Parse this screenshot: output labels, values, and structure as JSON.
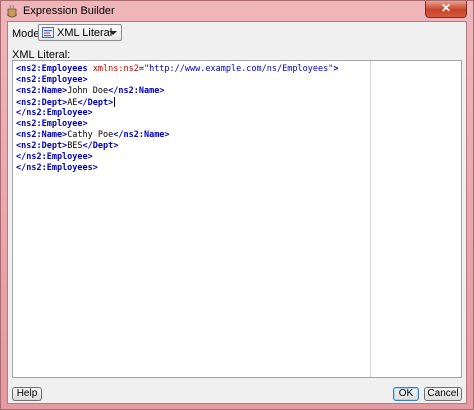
{
  "window": {
    "title": "Expression Builder",
    "close_glyph": "✕"
  },
  "mode": {
    "label": "Mode:",
    "value": "XML Literal"
  },
  "editor": {
    "label": "XML Literal:",
    "lines": [
      [
        {
          "t": "tag",
          "v": "<ns2:Employees "
        },
        {
          "t": "attr",
          "v": "xmlns:ns2"
        },
        {
          "t": "txt",
          "v": "="
        },
        {
          "t": "val",
          "v": "\"http://www.example.com/ns/Employees\""
        },
        {
          "t": "tag",
          "v": ">"
        }
      ],
      [
        {
          "t": "tag",
          "v": "<ns2:Employee>"
        }
      ],
      [
        {
          "t": "tag",
          "v": "<ns2:Name>"
        },
        {
          "t": "txt",
          "v": "John Doe"
        },
        {
          "t": "tag",
          "v": "</ns2:Name>"
        }
      ],
      [
        {
          "t": "tag",
          "v": "<ns2:Dept>"
        },
        {
          "t": "txt",
          "v": "AE"
        },
        {
          "t": "tag",
          "v": "</Dept>"
        },
        {
          "t": "caret",
          "v": ""
        }
      ],
      [
        {
          "t": "tag",
          "v": "</ns2:Employee>"
        }
      ],
      [
        {
          "t": "tag",
          "v": "<ns2:Employee>"
        }
      ],
      [
        {
          "t": "tag",
          "v": "<ns2:Name>"
        },
        {
          "t": "txt",
          "v": "Cathy Poe"
        },
        {
          "t": "tag",
          "v": "</ns2:Name>"
        }
      ],
      [
        {
          "t": "tag",
          "v": "<ns2:Dept>"
        },
        {
          "t": "txt",
          "v": "BES"
        },
        {
          "t": "tag",
          "v": "</Dept>"
        }
      ],
      [
        {
          "t": "tag",
          "v": "</ns2:Employee>"
        }
      ],
      [
        {
          "t": "tag",
          "v": "</ns2:Employees>"
        }
      ]
    ]
  },
  "buttons": {
    "help": "Help",
    "ok": "OK",
    "cancel": "Cancel"
  },
  "colors": {
    "tag": "#0000c0",
    "attribute": "#c00000",
    "text": "#000000",
    "window_frame": "#e7a3a8"
  }
}
